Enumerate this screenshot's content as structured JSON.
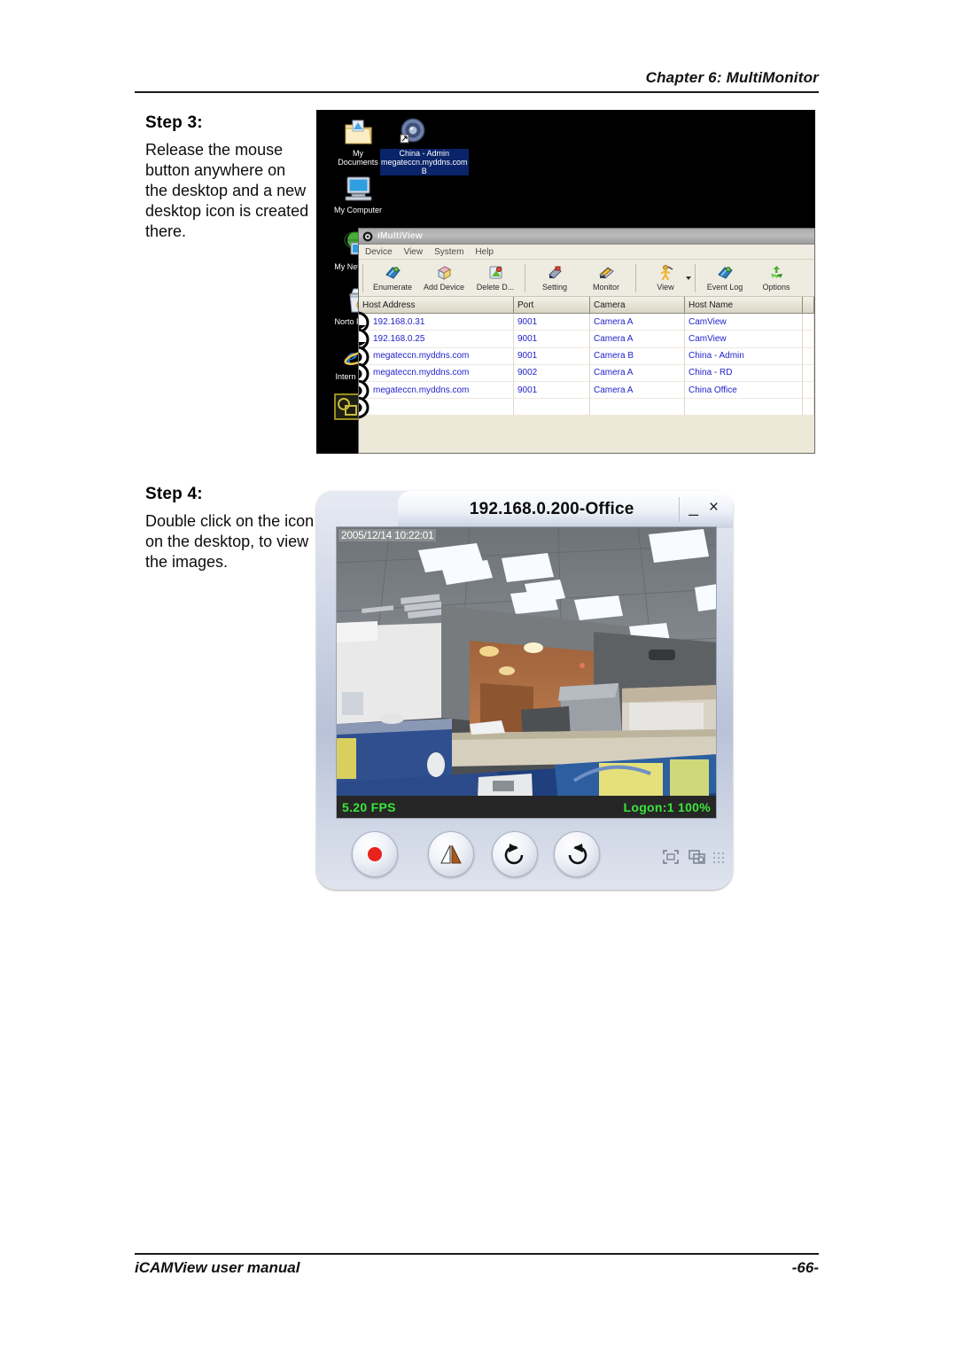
{
  "header": {
    "chapter": "Chapter 6: MultiMonitor"
  },
  "footer": {
    "left": "iCAMView user manual",
    "right": "-66-"
  },
  "step3": {
    "title": "Step",
    "number": "3:",
    "body": "Release the mouse button anywhere on the desktop and a new desktop icon is created there."
  },
  "step4": {
    "title": "Step",
    "number": "4:",
    "body": "Double click on the icon on the desktop, to view the images."
  },
  "desktop": {
    "icons": [
      {
        "name": "my-documents",
        "label": "My Documents",
        "selected": false
      },
      {
        "name": "china-admin-shortcut",
        "label": "China - Admin megateccn.myddns.com B",
        "selected": true
      },
      {
        "name": "my-computer",
        "label": "My Computer",
        "selected": false
      },
      {
        "name": "my-network-places",
        "label": "My Net Place",
        "selected": false
      },
      {
        "name": "norton-protected",
        "label": "Norto Protect",
        "selected": false
      },
      {
        "name": "internet-explorer",
        "label": "Intern Explor",
        "selected": false
      }
    ]
  },
  "imultiview": {
    "window_title": "iMultiView",
    "menus": [
      "Device",
      "View",
      "System",
      "Help"
    ],
    "toolbar": [
      {
        "label": "Enumerate",
        "icon": "enumerate-icon"
      },
      {
        "label": "Add Device",
        "icon": "add-device-icon"
      },
      {
        "label": "Delete D...",
        "icon": "delete-device-icon"
      },
      {
        "label": "Setting",
        "icon": "setting-icon"
      },
      {
        "label": "Monitor",
        "icon": "monitor-icon"
      },
      {
        "label": "View",
        "icon": "view-icon"
      },
      {
        "label": "Event Log",
        "icon": "event-log-icon"
      },
      {
        "label": "Options",
        "icon": "options-icon"
      }
    ],
    "table": {
      "columns": [
        "Host Address",
        "Port",
        "Camera",
        "Host Name",
        ""
      ],
      "rows": [
        {
          "host": "192.168.0.31",
          "port": "9001",
          "camera": "Camera A",
          "hostname": "CamView",
          "extra": ""
        },
        {
          "host": "192.168.0.25",
          "port": "9001",
          "camera": "Camera A",
          "hostname": "CamView",
          "extra": ""
        },
        {
          "host": "megateccn.myddns.com",
          "port": "9001",
          "camera": "Camera B",
          "hostname": "China - Admin",
          "extra": ""
        },
        {
          "host": "megateccn.myddns.com",
          "port": "9002",
          "camera": "Camera A",
          "hostname": "China - RD",
          "extra": ""
        },
        {
          "host": "megateccn.myddns.com",
          "port": "9001",
          "camera": "Camera A",
          "hostname": "China Office",
          "extra": ""
        }
      ]
    }
  },
  "viewer": {
    "title": "192.168.0.200-Office",
    "minimize": "_",
    "close": "×",
    "timestamp": "2005/12/14 10:22:01",
    "fps": "5.20 FPS",
    "logon": "Logon:1 100%",
    "buttons": [
      {
        "name": "record-button",
        "icon": "record-icon"
      },
      {
        "name": "mirror-button",
        "icon": "mirror-icon"
      },
      {
        "name": "rotate-left-button",
        "icon": "rotate-left-icon"
      },
      {
        "name": "rotate-right-button",
        "icon": "rotate-right-icon"
      }
    ],
    "corner_buttons": [
      {
        "name": "fullscreen-button",
        "icon": "fullscreen-icon"
      },
      {
        "name": "snapshot-button",
        "icon": "snapshot-icon"
      }
    ]
  },
  "colors": {
    "status_green": "#39e639",
    "link_blue": "#2222cc",
    "selection_blue": "#0a246a"
  }
}
